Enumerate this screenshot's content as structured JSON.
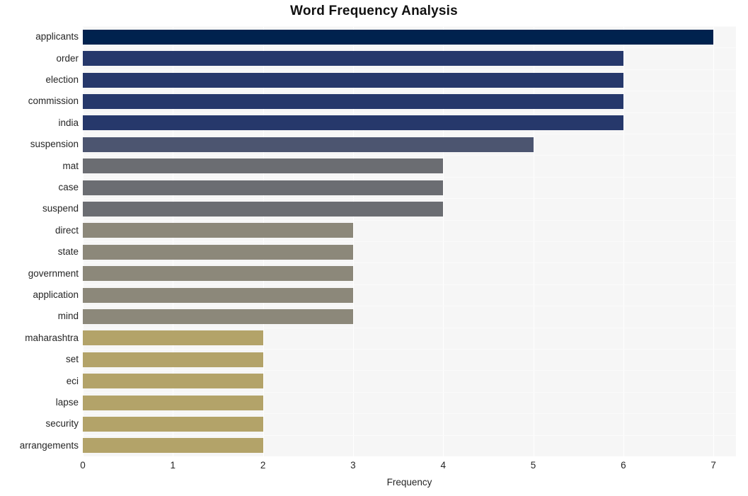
{
  "chart_data": {
    "type": "bar",
    "orientation": "horizontal",
    "title": "Word Frequency Analysis",
    "xlabel": "Frequency",
    "ylabel": "",
    "categories": [
      "applicants",
      "order",
      "election",
      "commission",
      "india",
      "suspension",
      "mat",
      "case",
      "suspend",
      "direct",
      "state",
      "government",
      "application",
      "mind",
      "maharashtra",
      "set",
      "eci",
      "lapse",
      "security",
      "arrangements"
    ],
    "values": [
      7,
      6,
      6,
      6,
      6,
      5,
      4,
      4,
      4,
      3,
      3,
      3,
      3,
      3,
      2,
      2,
      2,
      2,
      2,
      2
    ],
    "bar_colors": [
      "#00224e",
      "#26386b",
      "#26386b",
      "#26386b",
      "#26386b",
      "#4c5570",
      "#6b6d72",
      "#6b6d72",
      "#6b6d72",
      "#8c887a",
      "#8c887a",
      "#8c887a",
      "#8c887a",
      "#8c887a",
      "#b3a369",
      "#b3a369",
      "#b3a369",
      "#b3a369",
      "#b3a369",
      "#b3a369"
    ],
    "xticks": [
      "0",
      "1",
      "2",
      "3",
      "4",
      "5",
      "6",
      "7"
    ],
    "xtick_values": [
      0,
      1,
      2,
      3,
      4,
      5,
      6,
      7
    ],
    "xlim": [
      0,
      7.25
    ],
    "grid": true,
    "grid_color": "#ffffff",
    "plot_background": "#f6f6f6",
    "figure_background": "#ffffff",
    "legend": "none",
    "text_color": "#262626"
  }
}
